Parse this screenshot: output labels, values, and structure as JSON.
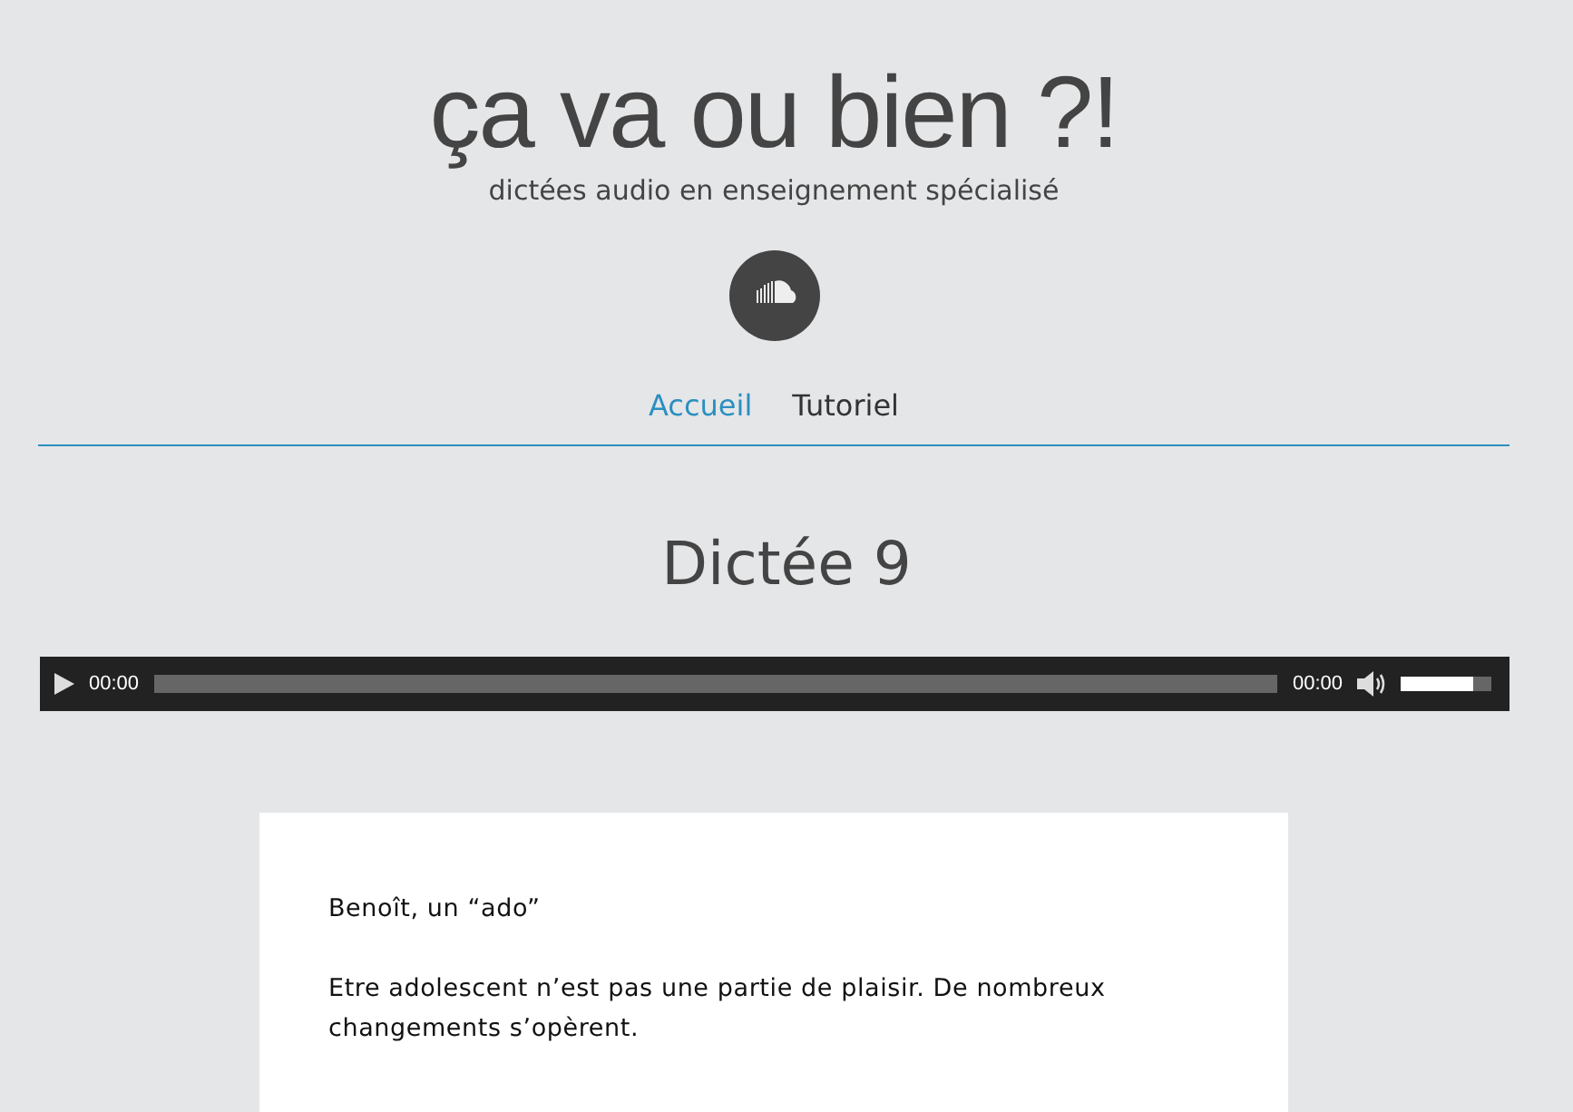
{
  "site": {
    "title": "ça va ou bien ?!",
    "tagline": "dictées audio en enseignement spécialisé"
  },
  "nav": [
    {
      "label": "Accueil",
      "selected": true
    },
    {
      "label": "Tutoriel",
      "selected": false
    }
  ],
  "post": {
    "title": "Dictée 9"
  },
  "player": {
    "current_time": "00:00",
    "duration": "00:00",
    "volume": {
      "level": 0.8
    }
  },
  "text": {
    "heading": "Benoît, un “ado”",
    "paragraphs": [
      "Etre adolescent n’est pas une partie de plaisir. De nombreux changements s’opèrent."
    ]
  }
}
